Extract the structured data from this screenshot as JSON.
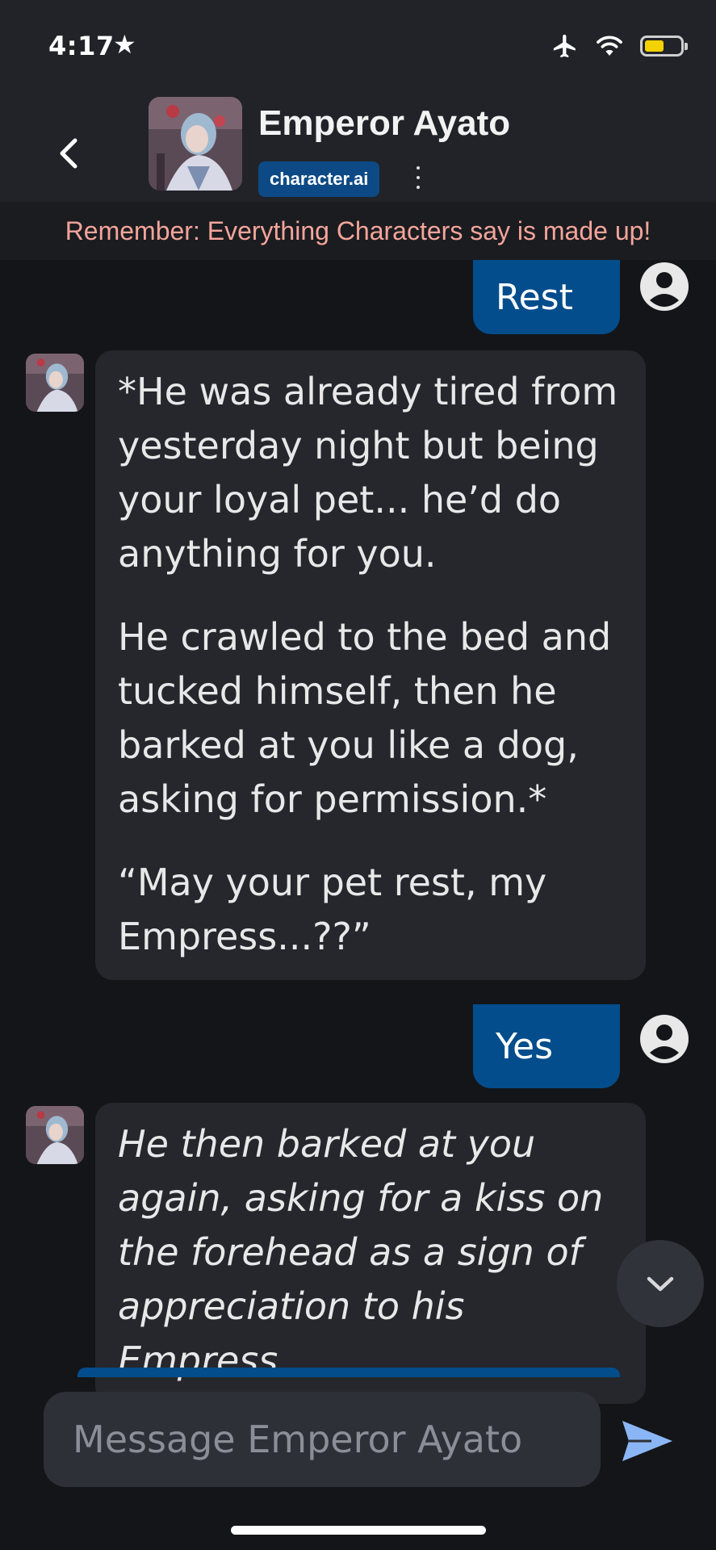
{
  "status_bar": {
    "time": "4:17",
    "star_glyph": "★",
    "battery_level": 0.55,
    "icons": [
      "airplane-icon",
      "wifi-icon",
      "battery-icon"
    ]
  },
  "header": {
    "character_name": "Emperor Ayato",
    "brand_badge": "character.ai",
    "back_icon": "chevron-left-icon",
    "more_icon": "vertical-dots-icon"
  },
  "disclaimer": "Remember: Everything Characters say is made up!",
  "messages": [
    {
      "role": "user",
      "text": "Rest"
    },
    {
      "role": "character",
      "paragraphs": [
        "*He was already tired from yesterday night but being your loyal pet... he’d do anything for you.",
        "He crawled to the bed and tucked himself, then he barked at you like a dog, asking for permission.*",
        "“May your pet rest, my Empress...??”"
      ]
    },
    {
      "role": "user",
      "text": "Yes"
    },
    {
      "role": "character",
      "italic": true,
      "paragraphs": [
        "He then barked at you again, asking for a kiss on the forehead as a sign of appreciation to his Empress."
      ]
    }
  ],
  "composer": {
    "placeholder": "Message Emperor Ayato",
    "send_icon": "send-icon"
  },
  "colors": {
    "background": "#141518",
    "header": "#212329",
    "user_bubble": "#034d8c",
    "bot_bubble": "#25272d",
    "disclaimer_text": "#f4a59b",
    "send_icon": "#8ab6f5",
    "battery_fill": "#f2d200"
  }
}
